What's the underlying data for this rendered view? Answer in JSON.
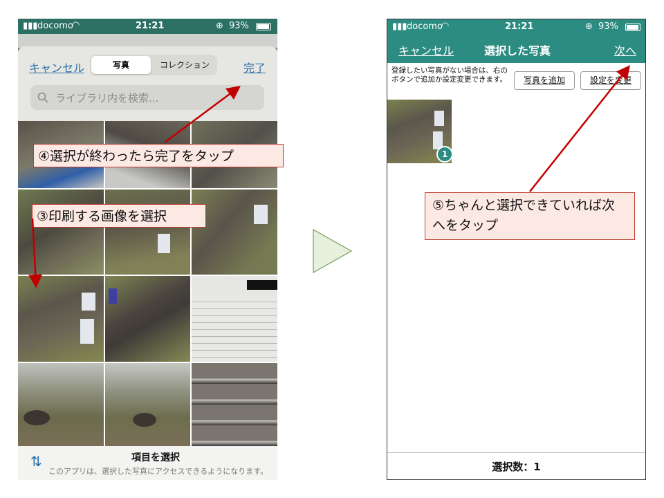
{
  "left_phone": {
    "status": {
      "carrier": "docomo",
      "time": "21:21",
      "battery": "93%"
    },
    "cancel": "キャンセル",
    "tabs": [
      {
        "label": "写真",
        "selected": true
      },
      {
        "label": "コレクション",
        "selected": false
      }
    ],
    "done": "完了",
    "search_placeholder": "ライブラリ内を検索...",
    "bottom_title": "項目を選択",
    "bottom_note": "このアプリは、選択した写真にアクセスできるようになります。"
  },
  "callouts": {
    "step4": "④選択が終わったら完了をタップ",
    "step3": "③印刷する画像を選択",
    "step5": "⑤ちゃんと選択できていれば次へをタップ"
  },
  "right_phone": {
    "status": {
      "carrier": "docomo",
      "time": "21:21",
      "battery": "93%"
    },
    "cancel": "キャンセル",
    "title": "選択した写真",
    "next": "次へ",
    "note": "登録したい写真がない場合は、右のボタンで追加か設定変更できます。",
    "add_button": "写真を追加",
    "settings_button": "設定を変更",
    "selected_badge": "1",
    "footer": "選択数：1"
  },
  "colors": {
    "teal_dark": "#2c6f63",
    "teal": "#2c8c82",
    "link_blue": "#2a6fa8",
    "arrow_red": "#c00000",
    "callout_bg": "#fde9e3"
  }
}
